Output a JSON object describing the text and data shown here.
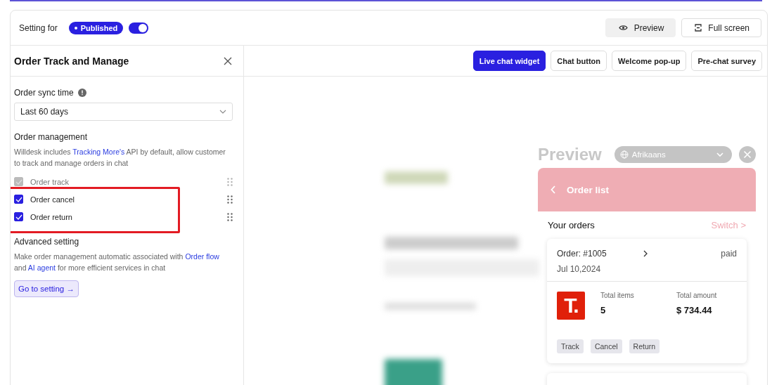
{
  "header": {
    "setting_label": "Setting for",
    "status_badge": "Published",
    "publish_toggle": {
      "on": true
    },
    "buttons": [
      {
        "kind": "preview",
        "label": "Preview"
      },
      {
        "kind": "fullscreen",
        "label": "Full screen"
      }
    ]
  },
  "panel": {
    "title": "Order Track and Manage",
    "sync_label": "Order sync time",
    "sync_select": {
      "value": "Last 60 days"
    },
    "management_title": "Order management",
    "management_desc": [
      {
        "text": "Willdesk includes ",
        "link": false
      },
      {
        "text": "Tracking More's",
        "link": true
      },
      {
        "text": " API by default, allow customer to track and manage orders in chat",
        "link": false
      }
    ],
    "options": [
      {
        "label": "Order track",
        "checked": true,
        "disabled": true
      },
      {
        "label": "Order cancel",
        "checked": true,
        "disabled": false
      },
      {
        "label": "Order return",
        "checked": true,
        "disabled": false
      }
    ],
    "advanced_title": "Advanced setting",
    "advanced_desc": [
      {
        "text": "Make order management automatic associated with ",
        "link": false
      },
      {
        "text": "Order flow",
        "link": true
      },
      {
        "text": " and ",
        "link": false
      },
      {
        "text": "AI agent",
        "link": true
      },
      {
        "text": " for more efficient services in chat",
        "link": false
      }
    ],
    "setting_button": "Go to setting →"
  },
  "tabs": [
    {
      "label": "Live chat widget",
      "selected": true
    },
    {
      "label": "Chat button",
      "selected": false
    },
    {
      "label": "Welcome pop-up",
      "selected": false
    },
    {
      "label": "Pre-chat survey",
      "selected": false
    }
  ],
  "preview": {
    "title": "Preview",
    "language": "Afrikaans",
    "widget_title": "Order list",
    "orders_title": "Your orders",
    "switch_link": "Switch >",
    "order": {
      "number": "Order: #1005",
      "status": "paid",
      "date": "Jul 10,2024",
      "logo_letter": "T.",
      "items_label": "Total items",
      "items_value": "5",
      "amount_label": "Total amount",
      "amount_value": "$ 734.44",
      "actions": [
        "Track",
        "Cancel",
        "Return"
      ]
    }
  }
}
